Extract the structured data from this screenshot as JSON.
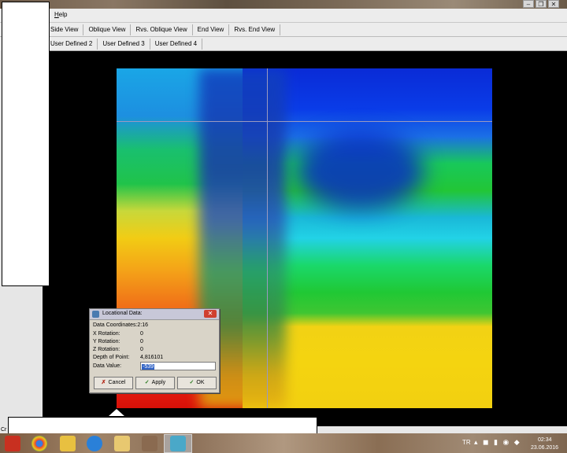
{
  "window": {
    "buttons": [
      "–",
      "❐",
      "✕"
    ]
  },
  "menu": {
    "help": "Help"
  },
  "views": {
    "tabs": [
      "Side View",
      "Oblique View",
      "Rvs. Oblique View",
      "End View",
      "Rvs. End View"
    ]
  },
  "user_views": {
    "tabs": [
      "User Defined 2",
      "User Defined 3",
      "User Defined 4"
    ]
  },
  "dialog": {
    "title": "Locational Data:",
    "close": "✕",
    "data_coordinates_label": "Data Coordinates:",
    "data_coordinates_value": "2:16",
    "x_rotation_label": "X Rotation:",
    "x_rotation_value": "0",
    "y_rotation_label": "Y Rotation:",
    "y_rotation_value": "0",
    "z_rotation_label": "Z Rotation:",
    "z_rotation_value": "0",
    "depth_label": "Depth of Point:",
    "depth_value": "4,816101",
    "data_value_label": "Data Value:",
    "data_value_input": "-539",
    "cancel_label": "Cancel",
    "apply_label": "Apply",
    "ok_label": "OK"
  },
  "statusbar": {
    "text": "Cr"
  },
  "taskbar": {
    "lang": "TR",
    "time": "02:34",
    "date": "23.06.2016"
  },
  "colors": {
    "heatmap_blue": "#0a2bd6",
    "heatmap_green": "#20c834",
    "heatmap_yellow": "#f4d410",
    "heatmap_red": "#e62010"
  }
}
